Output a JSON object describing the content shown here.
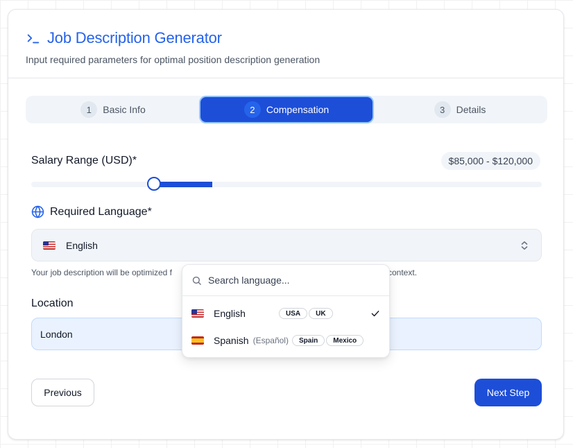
{
  "header": {
    "title": "Job Description Generator",
    "subtitle": "Input required parameters for optimal position description generation",
    "icon": "terminal-icon"
  },
  "steps": [
    {
      "number": "1",
      "label": "Basic Info",
      "active": false
    },
    {
      "number": "2",
      "label": "Compensation",
      "active": true
    },
    {
      "number": "3",
      "label": "Details",
      "active": false
    }
  ],
  "salary": {
    "label": "Salary Range (USD)*",
    "badge": "$85,000 - $120,000",
    "range_fraction": [
      0.24,
      0.355
    ]
  },
  "language": {
    "label": "Required Language*",
    "icon": "globe-icon",
    "selected_value": "English",
    "helper_visible_start": "Your job description will be optimized f",
    "helper_visible_end": "l context."
  },
  "location": {
    "label": "Location",
    "value": "London"
  },
  "dropdown": {
    "search_placeholder": "Search language...",
    "options": [
      {
        "name": "English",
        "native": "",
        "tags": [
          "USA",
          "UK"
        ],
        "selected": true
      },
      {
        "name": "Spanish",
        "native": "(Español)",
        "tags": [
          "Spain",
          "Mexico"
        ],
        "selected": false
      }
    ]
  },
  "buttons": {
    "previous": "Previous",
    "next": "Next Step"
  },
  "colors": {
    "accent": "#1d4ed8",
    "title": "#2563eb"
  }
}
